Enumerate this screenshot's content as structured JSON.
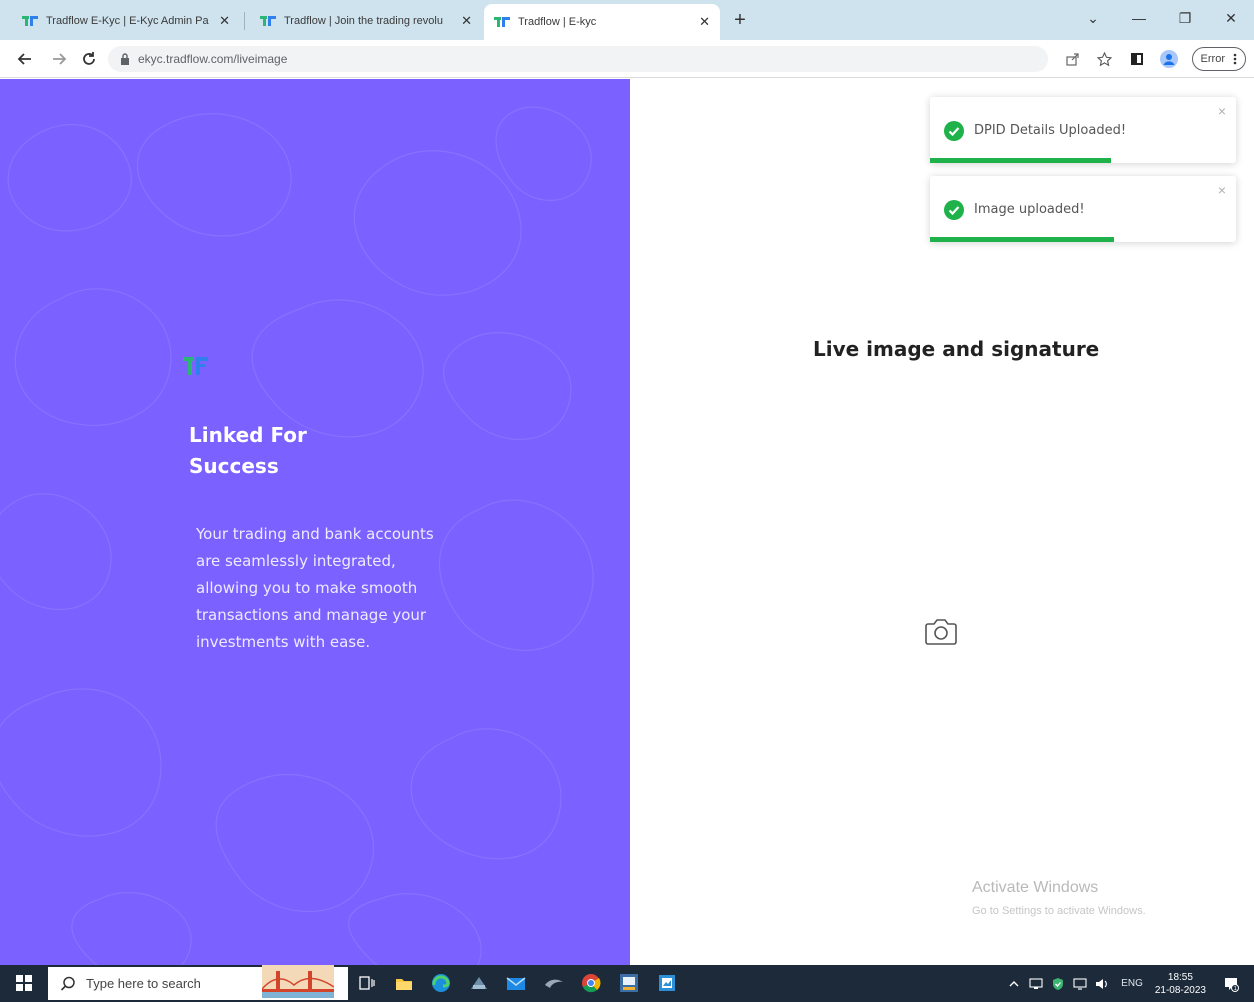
{
  "browser": {
    "tabs": [
      {
        "title": "Tradflow E-Kyc | E-Kyc Admin Pa",
        "active": false
      },
      {
        "title": "Tradflow | Join the trading revolu",
        "active": false
      },
      {
        "title": "Tradflow | E-kyc",
        "active": true
      }
    ],
    "tab_close_glyph": "✕",
    "new_tab_glyph": "+",
    "window_controls": {
      "tab_search": "⌄",
      "minimize": "—",
      "restore": "❐",
      "close": "✕"
    },
    "url": "ekyc.tradflow.com/liveimage",
    "profile_status": "Error"
  },
  "left_panel": {
    "headline_line1": "Linked For",
    "headline_line2": "Success",
    "description": "Your trading and bank accounts are seamlessly integrated, allowing you to make smooth transactions and manage your investments with ease."
  },
  "main": {
    "heading": "Live image and signature",
    "camera_icon": "camera-icon"
  },
  "toasts": [
    {
      "message": "DPID Details Uploaded!",
      "progress": 0.59
    },
    {
      "message": "Image uploaded!",
      "progress": 0.6
    }
  ],
  "toast_close_glyph": "×",
  "watermark": {
    "title": "Activate Windows",
    "subtitle": "Go to Settings to activate Windows."
  },
  "taskbar": {
    "search_placeholder": "Type here to search",
    "language": "ENG",
    "time": "18:55",
    "date": "21-08-2023"
  },
  "colors": {
    "panel_purple": "#7b61ff",
    "toast_green": "#1fb24a",
    "tabstrip": "#cfe3ee",
    "taskbar": "#1c2a3a"
  }
}
